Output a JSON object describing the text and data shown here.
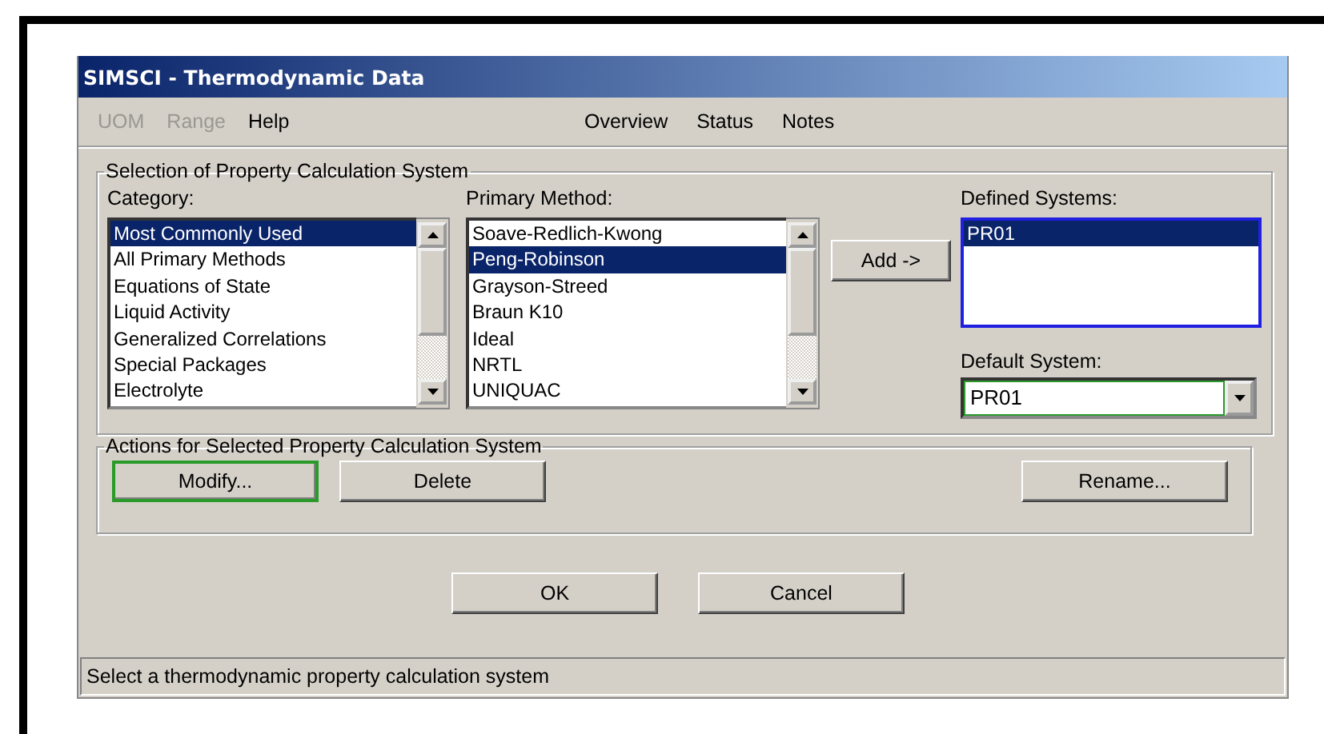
{
  "window": {
    "title": "SIMSCI - Thermodynamic Data"
  },
  "menu_left": [
    {
      "label": "UOM",
      "disabled": true
    },
    {
      "label": "Range",
      "disabled": true
    },
    {
      "label": "Help",
      "disabled": false
    }
  ],
  "menu_right": [
    {
      "label": "Overview",
      "disabled": false
    },
    {
      "label": "Status",
      "disabled": false
    },
    {
      "label": "Notes",
      "disabled": false
    }
  ],
  "selection_group": {
    "title": "Selection of Property Calculation System",
    "category": {
      "label": "Category:",
      "items": [
        {
          "label": "Most Commonly Used",
          "selected": true
        },
        {
          "label": "All Primary Methods",
          "selected": false
        },
        {
          "label": "Equations of State",
          "selected": false
        },
        {
          "label": "Liquid Activity",
          "selected": false
        },
        {
          "label": "Generalized Correlations",
          "selected": false
        },
        {
          "label": "Special Packages",
          "selected": false
        },
        {
          "label": "Electrolyte",
          "selected": false
        }
      ]
    },
    "primary_method": {
      "label": "Primary Method:",
      "items": [
        {
          "label": "Soave-Redlich-Kwong",
          "selected": false
        },
        {
          "label": "Peng-Robinson",
          "selected": true
        },
        {
          "label": "Grayson-Streed",
          "selected": false
        },
        {
          "label": "Braun K10",
          "selected": false
        },
        {
          "label": "Ideal",
          "selected": false
        },
        {
          "label": "NRTL",
          "selected": false
        },
        {
          "label": "UNIQUAC",
          "selected": false
        }
      ]
    },
    "add_button": "Add ->",
    "defined_systems": {
      "label": "Defined Systems:",
      "items": [
        {
          "label": "PR01",
          "selected": true
        }
      ]
    },
    "default_system": {
      "label": "Default System:",
      "value": "PR01"
    }
  },
  "actions_group": {
    "title": "Actions for Selected Property Calculation System",
    "buttons": [
      {
        "label": "Modify...",
        "focused": true
      },
      {
        "label": "Delete",
        "focused": false
      },
      {
        "label": "Rename...",
        "focused": false
      }
    ]
  },
  "dialog_buttons": [
    "OK",
    "Cancel"
  ],
  "status_bar": "Select a thermodynamic property calculation system"
}
